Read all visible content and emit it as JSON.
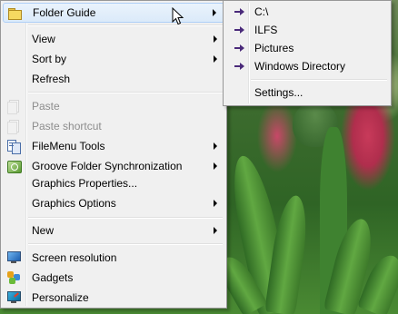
{
  "context_menu": {
    "items": [
      {
        "label": "Folder Guide",
        "icon": "folder-icon",
        "submenu": true,
        "highlighted": true
      },
      {
        "label": "View",
        "submenu": true
      },
      {
        "label": "Sort by",
        "submenu": true
      },
      {
        "label": "Refresh"
      },
      {
        "label": "Paste",
        "icon": "paste-icon",
        "disabled": true
      },
      {
        "label": "Paste shortcut",
        "icon": "paste-shortcut-icon",
        "disabled": true
      },
      {
        "label": "FileMenu Tools",
        "icon": "filemenu-tools-icon",
        "submenu": true
      },
      {
        "label": "Groove Folder Synchronization",
        "icon": "groove-icon",
        "submenu": true
      },
      {
        "label": "Graphics Properties..."
      },
      {
        "label": "Graphics Options",
        "submenu": true
      },
      {
        "label": "New",
        "submenu": true
      },
      {
        "label": "Screen resolution",
        "icon": "screen-resolution-icon"
      },
      {
        "label": "Gadgets",
        "icon": "gadgets-icon"
      },
      {
        "label": "Personalize",
        "icon": "personalize-icon"
      }
    ]
  },
  "folder_guide_submenu": {
    "items": [
      {
        "label": "C:\\",
        "icon": "arrow-right-icon"
      },
      {
        "label": "ILFS",
        "icon": "arrow-right-icon"
      },
      {
        "label": "Pictures",
        "icon": "arrow-right-icon"
      },
      {
        "label": "Windows Directory",
        "icon": "arrow-right-icon"
      },
      {
        "label": "Settings..."
      }
    ]
  },
  "colors": {
    "menu_background": "#f0f0f0",
    "menu_border": "#979797",
    "highlight": "#dbeaf9",
    "submenu_arrow": "#4a2a7a"
  }
}
